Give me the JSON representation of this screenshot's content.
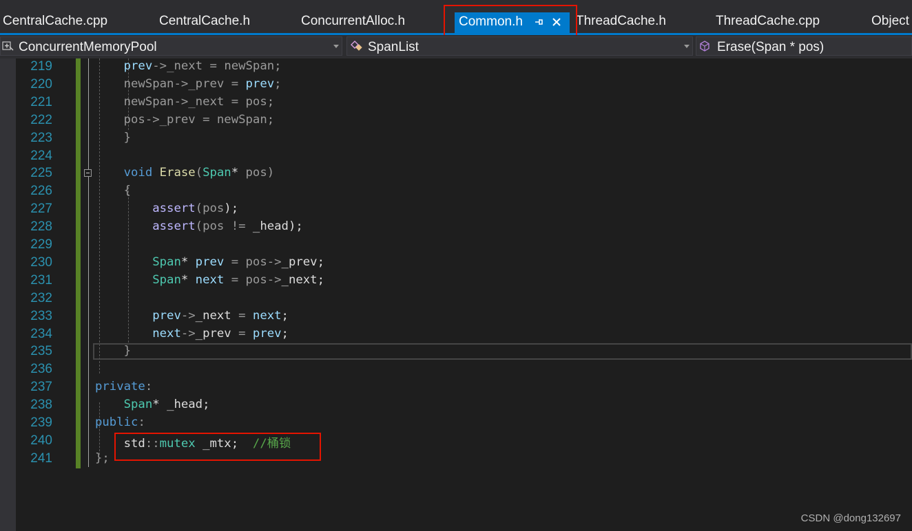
{
  "tabs": {
    "items": [
      {
        "label": "CentralCache.cpp",
        "active": false
      },
      {
        "label": "CentralCache.h",
        "active": false
      },
      {
        "label": "ConcurrentAlloc.h",
        "active": false
      },
      {
        "label": "Common.h",
        "active": true
      },
      {
        "label": "ThreadCache.h",
        "active": false
      },
      {
        "label": "ThreadCache.cpp",
        "active": false
      },
      {
        "label": "Object",
        "active": false
      }
    ]
  },
  "navbar": {
    "project": "ConcurrentMemoryPool",
    "scope": "SpanList",
    "member": "Erase(Span * pos)"
  },
  "colors": {
    "accent": "#007acc",
    "background": "#1e1e1e",
    "line_number": "#2b91af",
    "change_bar": "#588226",
    "highlight_box": "#e51400"
  },
  "editor": {
    "lines": [
      {
        "n": "219",
        "segs": [
          [
            "    ",
            ""
          ],
          [
            "prev",
            "var"
          ],
          [
            "->",
            "gr"
          ],
          [
            "_next",
            "gr"
          ],
          [
            " = ",
            "gr"
          ],
          [
            "newSpan",
            "gr"
          ],
          [
            ";",
            "gr"
          ]
        ]
      },
      {
        "n": "220",
        "segs": [
          [
            "    ",
            ""
          ],
          [
            "newSpan",
            "gr"
          ],
          [
            "->",
            "gr"
          ],
          [
            "_prev",
            "gr"
          ],
          [
            " = ",
            "gr"
          ],
          [
            "prev",
            "var"
          ],
          [
            ";",
            "gr"
          ]
        ]
      },
      {
        "n": "221",
        "segs": [
          [
            "    ",
            ""
          ],
          [
            "newSpan",
            "gr"
          ],
          [
            "->",
            "gr"
          ],
          [
            "_next",
            "gr"
          ],
          [
            " = ",
            "gr"
          ],
          [
            "pos",
            "gr"
          ],
          [
            ";",
            "gr"
          ]
        ]
      },
      {
        "n": "222",
        "segs": [
          [
            "    ",
            ""
          ],
          [
            "pos",
            "gr"
          ],
          [
            "->",
            "gr"
          ],
          [
            "_prev",
            "gr"
          ],
          [
            " = ",
            "gr"
          ],
          [
            "newSpan",
            "gr"
          ],
          [
            ";",
            "gr"
          ]
        ]
      },
      {
        "n": "223",
        "segs": [
          [
            "    ",
            ""
          ],
          [
            "}",
            "gr"
          ]
        ]
      },
      {
        "n": "224",
        "segs": []
      },
      {
        "n": "225",
        "segs": [
          [
            "    ",
            ""
          ],
          [
            "void",
            "kw"
          ],
          [
            " ",
            ""
          ],
          [
            "Erase",
            "fn"
          ],
          [
            "(",
            "gr"
          ],
          [
            "Span",
            "ty"
          ],
          [
            "* ",
            ""
          ],
          [
            "pos",
            "gr"
          ],
          [
            ")",
            "gr"
          ]
        ]
      },
      {
        "n": "226",
        "segs": [
          [
            "    ",
            ""
          ],
          [
            "{",
            "gr"
          ]
        ]
      },
      {
        "n": "227",
        "segs": [
          [
            "        ",
            ""
          ],
          [
            "assert",
            "mac"
          ],
          [
            "(",
            "gr"
          ],
          [
            "pos",
            "gr"
          ],
          [
            ");",
            ""
          ]
        ]
      },
      {
        "n": "228",
        "segs": [
          [
            "        ",
            ""
          ],
          [
            "assert",
            "mac"
          ],
          [
            "(",
            "gr"
          ],
          [
            "pos",
            "gr"
          ],
          [
            " != ",
            "gr"
          ],
          [
            "_head",
            ""
          ],
          [
            ");",
            ""
          ]
        ]
      },
      {
        "n": "229",
        "segs": []
      },
      {
        "n": "230",
        "segs": [
          [
            "        ",
            ""
          ],
          [
            "Span",
            "ty"
          ],
          [
            "* ",
            ""
          ],
          [
            "prev",
            "var"
          ],
          [
            " = ",
            "gr"
          ],
          [
            "pos",
            "gr"
          ],
          [
            "->",
            "gr"
          ],
          [
            "_prev",
            ""
          ],
          [
            ";",
            ""
          ]
        ]
      },
      {
        "n": "231",
        "segs": [
          [
            "        ",
            ""
          ],
          [
            "Span",
            "ty"
          ],
          [
            "* ",
            ""
          ],
          [
            "next",
            "var"
          ],
          [
            " = ",
            "gr"
          ],
          [
            "pos",
            "gr"
          ],
          [
            "->",
            "gr"
          ],
          [
            "_next",
            ""
          ],
          [
            ";",
            ""
          ]
        ]
      },
      {
        "n": "232",
        "segs": []
      },
      {
        "n": "233",
        "segs": [
          [
            "        ",
            ""
          ],
          [
            "prev",
            "var"
          ],
          [
            "->",
            "gr"
          ],
          [
            "_next",
            ""
          ],
          [
            " = ",
            "gr"
          ],
          [
            "next",
            "var"
          ],
          [
            ";",
            ""
          ]
        ]
      },
      {
        "n": "234",
        "segs": [
          [
            "        ",
            ""
          ],
          [
            "next",
            "var"
          ],
          [
            "->",
            "gr"
          ],
          [
            "_prev",
            ""
          ],
          [
            " = ",
            "gr"
          ],
          [
            "prev",
            "var"
          ],
          [
            ";",
            ""
          ]
        ]
      },
      {
        "n": "235",
        "segs": [
          [
            "    ",
            ""
          ],
          [
            "}",
            "gr"
          ]
        ]
      },
      {
        "n": "236",
        "segs": []
      },
      {
        "n": "237",
        "segs": [
          [
            "private",
            "kw"
          ],
          [
            ":",
            "gr"
          ]
        ]
      },
      {
        "n": "238",
        "segs": [
          [
            "    ",
            ""
          ],
          [
            "Span",
            "ty"
          ],
          [
            "* ",
            ""
          ],
          [
            "_head",
            ""
          ],
          [
            ";",
            ""
          ]
        ]
      },
      {
        "n": "239",
        "segs": [
          [
            "public",
            "kw"
          ],
          [
            ":",
            "gr"
          ]
        ]
      },
      {
        "n": "240",
        "segs": [
          [
            "    ",
            ""
          ],
          [
            "std",
            ""
          ],
          [
            "::",
            "gr"
          ],
          [
            "mutex",
            "ty"
          ],
          [
            " _mtx;  ",
            ""
          ],
          [
            "//桶锁",
            "cm"
          ]
        ]
      },
      {
        "n": "241",
        "segs": [
          [
            "};",
            "gr"
          ]
        ]
      }
    ]
  },
  "watermark": "CSDN @dong132697"
}
